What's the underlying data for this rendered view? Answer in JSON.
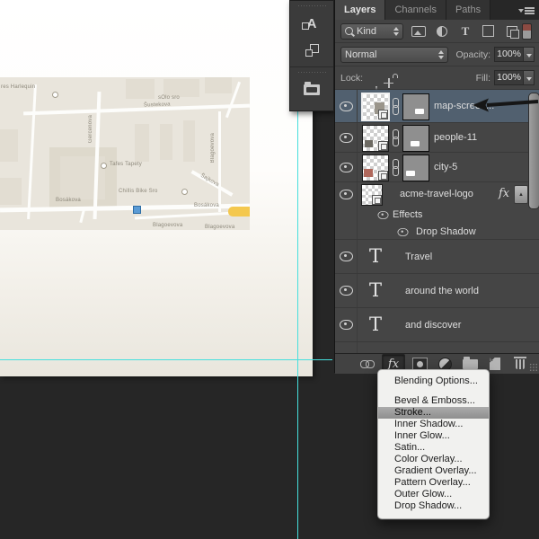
{
  "colors": {
    "guide_cyan": "#45dfdd",
    "selected_layer_row": "#51606f",
    "menu_highlight_gray": "#9a9a9a",
    "map_marker_blue": "#5b9bd5",
    "road_highlight_yellow": "#f4c84e",
    "panel_bg": "#454545",
    "pasteboard": "#262626"
  },
  "canvas": {
    "map": {
      "labels": [
        "res Harlequin",
        "sOlo sro",
        "Šustekova",
        "Gercenova",
        "Blagoevova",
        "Tafes Tapety",
        "Chillis Bike Sro",
        "Bosákova",
        "Bosákova",
        "Šajkova",
        "Blagoevova",
        "Blagoevova"
      ]
    }
  },
  "dock": {
    "panels": [
      "character-styles",
      "layer-comps",
      "libraries"
    ]
  },
  "layers_panel": {
    "tabs": [
      {
        "label": "Layers"
      },
      {
        "label": "Channels"
      },
      {
        "label": "Paths"
      }
    ],
    "filter": {
      "kind_label": "Kind"
    },
    "blend_mode": "Normal",
    "opacity_label": "Opacity:",
    "opacity_value": "100%",
    "lock_label": "Lock:",
    "fill_label": "Fill:",
    "fill_value": "100%",
    "rows": [
      {
        "name": "map-screen...",
        "type": "smart-object",
        "selected": true,
        "has_mask": true
      },
      {
        "name": "people-11",
        "type": "smart-object",
        "has_mask": true
      },
      {
        "name": "city-5",
        "type": "smart-object",
        "has_mask": true
      },
      {
        "name": "acme-travel-logo",
        "type": "smart-object",
        "has_effects": true
      },
      {
        "name": "Effects",
        "type": "effects-header"
      },
      {
        "name": "Drop Shadow",
        "type": "effect"
      },
      {
        "name": "Travel",
        "type": "text"
      },
      {
        "name": "around the world",
        "type": "text"
      },
      {
        "name": "and discover",
        "type": "text"
      }
    ]
  },
  "fx_menu": {
    "items": [
      "Blending Options...",
      "Bevel & Emboss...",
      "Stroke...",
      "Inner Shadow...",
      "Inner Glow...",
      "Satin...",
      "Color Overlay...",
      "Gradient Overlay...",
      "Pattern Overlay...",
      "Outer Glow...",
      "Drop Shadow..."
    ],
    "highlighted": "Stroke..."
  },
  "icons": {
    "text_layer_glyph": "T",
    "fx_glyph": "fx",
    "collapse_glyph": "▲",
    "names": [
      "panel-menu-icon",
      "search-icon",
      "pixel-filter-icon",
      "adjustment-filter-icon",
      "type-filter-icon",
      "shape-filter-icon",
      "smart-object-filter-icon",
      "filter-toggle",
      "lock-transparency-icon",
      "lock-pixels-icon",
      "lock-position-icon",
      "lock-all-icon",
      "eye-icon",
      "chain-link-icon",
      "smart-object-badge",
      "link-layers-icon",
      "fx-icon",
      "add-mask-icon",
      "new-adjustment-icon",
      "new-group-icon",
      "new-layer-icon",
      "delete-layer-icon",
      "character-styles-icon",
      "layer-comps-icon",
      "libraries-icon",
      "annotation-arrow"
    ]
  }
}
